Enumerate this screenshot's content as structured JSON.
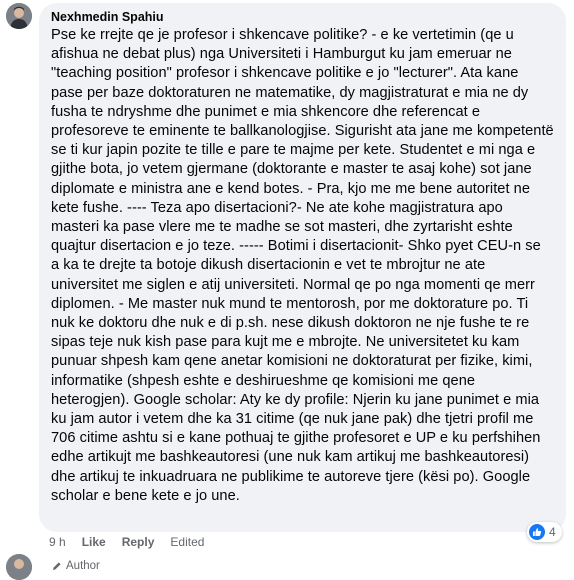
{
  "comment": {
    "author": "Nexhmedin Spahiu",
    "text": "Pse ke rrejte qe je profesor i shkencave politike? - e ke vertetimin (qe u\nafishua ne debat plus) nga Universiteti i Hamburgut ku jam emeruar ne\n\"teaching position\" profesor i shkencave politike e jo \"lecturer\". Ata kane\npase per baze doktoraturen ne matematike, dy magjistraturat e mia ne dy\nfusha te ndryshme dhe punimet e mia shkencore dhe referencat e\nprofesoreve te eminente te ballkanologjise. Sigurisht ata jane me kompetentë\nse ti kur japin pozite te tille e pare te majme per kete. Studentet e mi nga e\ngjithe bota, jo vetem gjermane (doktorante e master te asaj kohe) sot jane\ndiplomate e ministra ane e kend botes. - Pra, kjo me me bene autoritet ne\nkete fushe. ---- Teza apo disertacioni?- Ne ate kohe magjistratura apo\nmasteri ka pase vlere me te madhe se sot masteri, dhe zyrtarisht eshte\nquajtur disertacion e jo teze. ----- Botimi i disertacionit- Shko pyet CEU-n se\na ka te drejte ta botoje dikush disertacionin e vet te mbrojtur ne ate\nuniversitet me siglen e atij universiteti. Normal qe po nga momenti qe merr\ndiplomen. - Me master nuk mund te mentorosh, por me doktorature po. Ti\nnuk ke doktoru dhe nuk e di p.sh. nese dikush doktoron ne nje fushe te re\nsipas teje nuk kish pase para kujt me e mbrojte. Ne universitetet ku kam\npunuar shpesh kam qene anetar komisioni ne doktoraturat per fizike, kimi,\ninformatike (shpesh eshte e deshirueshme qe komisioni me qene\nheterogjen). Google scholar: Aty ke dy profile: Njerin ku jane punimet e mia\nku jam autor i vetem dhe ka 31 citime (qe nuk jane pak) dhe tjetri profil me\n706 citime ashtu si e kane pothuaj te gjithe profesoret e UP e ku perfshihen\nedhe artikujt me bashkeautoresi (une nuk kam artikuj me bashkeautoresi)\ndhe artikuj te inkuadruara ne publikime te autoreve tjere (kësi po). Google\nscholar e bene kete e jo une.",
    "time": "9 h",
    "like_label": "Like",
    "reply_label": "Reply",
    "edited_label": "Edited",
    "reaction_count": "4"
  },
  "next_comment": {
    "badge": "Author"
  },
  "colors": {
    "bubble": "#f0f2f5",
    "like_blue": "#1877f2",
    "meta_gray": "#65676b"
  }
}
